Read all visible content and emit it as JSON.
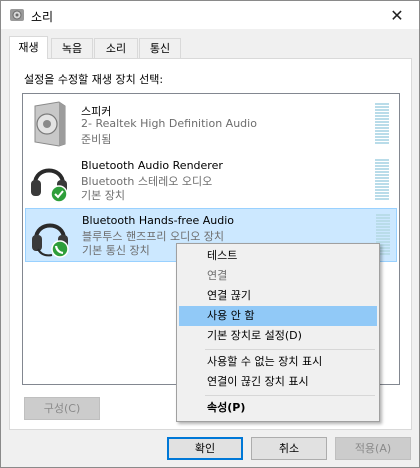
{
  "window": {
    "title": "소리"
  },
  "tabs": [
    "재생",
    "녹음",
    "소리",
    "통신"
  ],
  "instruction": "설정을 수정할 재생 장치 선택:",
  "devices": [
    {
      "name": "스피커",
      "detail": "2- Realtek High Definition Audio",
      "status": "준비됨"
    },
    {
      "name": "Bluetooth Audio Renderer",
      "detail": "Bluetooth 스테레오 오디오",
      "status": "기본 장치"
    },
    {
      "name": "Bluetooth Hands-free Audio",
      "detail": "블루투스 핸즈프리 오디오 장치",
      "status": "기본 통신 장치"
    }
  ],
  "context_menu": {
    "items": [
      "테스트",
      "연결",
      "연결 끊기",
      "사용 안 함",
      "기본 장치로 설정(D)",
      "사용할 수 없는 장치 표시",
      "연결이 끊긴 장치 표시",
      "속성(P)"
    ]
  },
  "buttons": {
    "configure": "구성(C)",
    "ok": "확인",
    "cancel": "취소",
    "apply": "적용(A)"
  },
  "colors": {
    "selection": "#cce8ff",
    "menu_highlight": "#91c9f7",
    "check_green": "#2e9e3a"
  },
  "icons": {
    "title": "speaker-icon",
    "device_1": "speaker-device-icon",
    "device_2": "headphones-icon",
    "device_3": "headset-icon"
  }
}
